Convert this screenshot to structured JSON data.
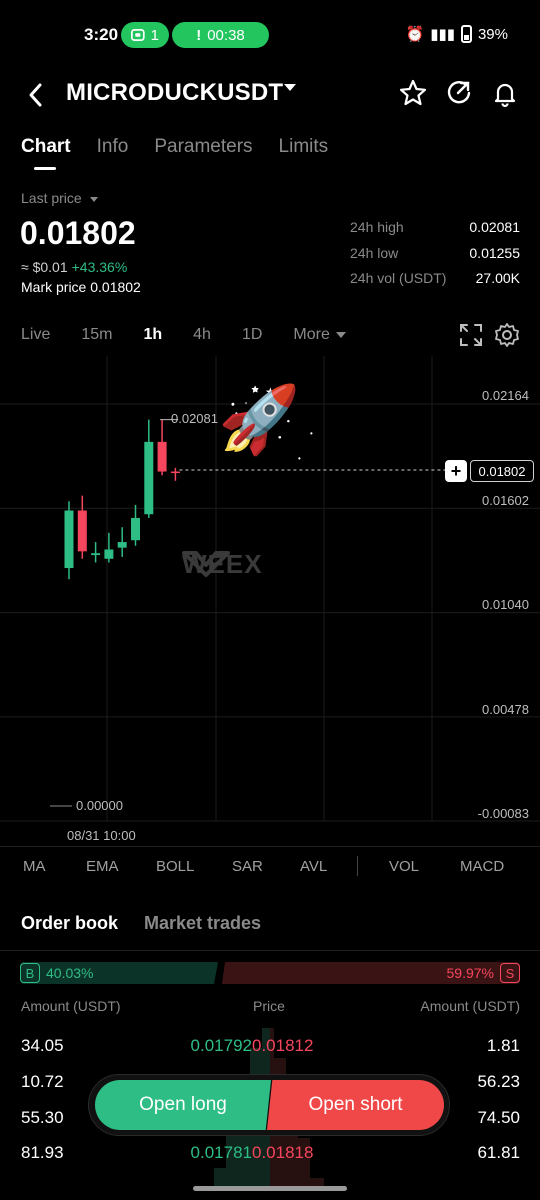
{
  "status_bar": {
    "time": "3:20",
    "notif_count": "1",
    "call_timer": "00:38",
    "battery": "39%"
  },
  "header": {
    "pair": "MICRODUCKUSDT",
    "icons": [
      "back-arrow-icon",
      "star-icon",
      "share-icon",
      "bell-icon"
    ]
  },
  "tabs": [
    "Chart",
    "Info",
    "Parameters",
    "Limits"
  ],
  "price": {
    "label": "Last price",
    "value": "0.01802",
    "usd": "≈ $0.01",
    "change": "+43.36%",
    "mark_price": "Mark price 0.01802"
  },
  "stats": [
    {
      "k": "24h high",
      "v": "0.02081"
    },
    {
      "k": "24h low",
      "v": "0.01255"
    },
    {
      "k": "24h vol (USDT)",
      "v": "27.00K"
    }
  ],
  "intervals": [
    "Live",
    "15m",
    "1h",
    "4h",
    "1D",
    "More"
  ],
  "chart": {
    "y_labels": [
      "0.02164",
      "0.01602",
      "0.01040",
      "0.00478",
      "-0.00083"
    ],
    "current_price": "0.01802",
    "high_label": "0.02081",
    "low_label": "0.00000",
    "date_label": "08/31 10:00",
    "watermark": "WEEX",
    "rocket": "🚀"
  },
  "chart_data": {
    "type": "candlestick",
    "title": "",
    "ylim": [
      -0.00083,
      0.02164
    ],
    "candles": [
      {
        "o": 0.0128,
        "c": 0.0159,
        "h": 0.0164,
        "l": 0.0122,
        "dir": "up"
      },
      {
        "o": 0.0159,
        "c": 0.0137,
        "h": 0.0167,
        "l": 0.0133,
        "dir": "down"
      },
      {
        "o": 0.0136,
        "c": 0.0135,
        "h": 0.0142,
        "l": 0.0131,
        "dir": "up"
      },
      {
        "o": 0.0133,
        "c": 0.0138,
        "h": 0.0147,
        "l": 0.0131,
        "dir": "up"
      },
      {
        "o": 0.0139,
        "c": 0.0142,
        "h": 0.015,
        "l": 0.0134,
        "dir": "up"
      },
      {
        "o": 0.0143,
        "c": 0.0155,
        "h": 0.0162,
        "l": 0.014,
        "dir": "up"
      },
      {
        "o": 0.0157,
        "c": 0.0196,
        "h": 0.0208,
        "l": 0.0155,
        "dir": "up"
      },
      {
        "o": 0.0196,
        "c": 0.018,
        "h": 0.0208,
        "l": 0.0178,
        "dir": "down"
      },
      {
        "o": 0.018,
        "c": 0.018,
        "h": 0.0182,
        "l": 0.0175,
        "dir": "down"
      }
    ]
  },
  "indicators": [
    "MA",
    "EMA",
    "BOLL",
    "SAR",
    "AVL",
    "VOL",
    "MACD"
  ],
  "orderbook": {
    "tabs": [
      "Order book",
      "Market trades"
    ],
    "buy_badge": "B",
    "buy_pct": "40.03%",
    "sell_badge": "S",
    "sell_pct": "59.97%",
    "head_amount": "Amount (USDT)",
    "head_price": "Price",
    "head_amount2": "Amount (USDT)",
    "rows": [
      {
        "amt": "34.05",
        "bp": "0.01792",
        "sp": "0.01812",
        "samt": "1.81"
      },
      {
        "amt": "10.72",
        "bp": "",
        "sp": "",
        "samt": "56.23"
      },
      {
        "amt": "55.30",
        "bp": "",
        "sp": "",
        "samt": "74.50"
      },
      {
        "amt": "81.93",
        "bp": "0.01781",
        "sp": "0.01818",
        "samt": "61.81"
      }
    ]
  },
  "actions": {
    "long": "Open long",
    "short": "Open short"
  },
  "colors": {
    "up": "#2ebd85",
    "down": "#f6465d",
    "long_btn": "#2ebd85",
    "short_btn": "#f04848"
  }
}
